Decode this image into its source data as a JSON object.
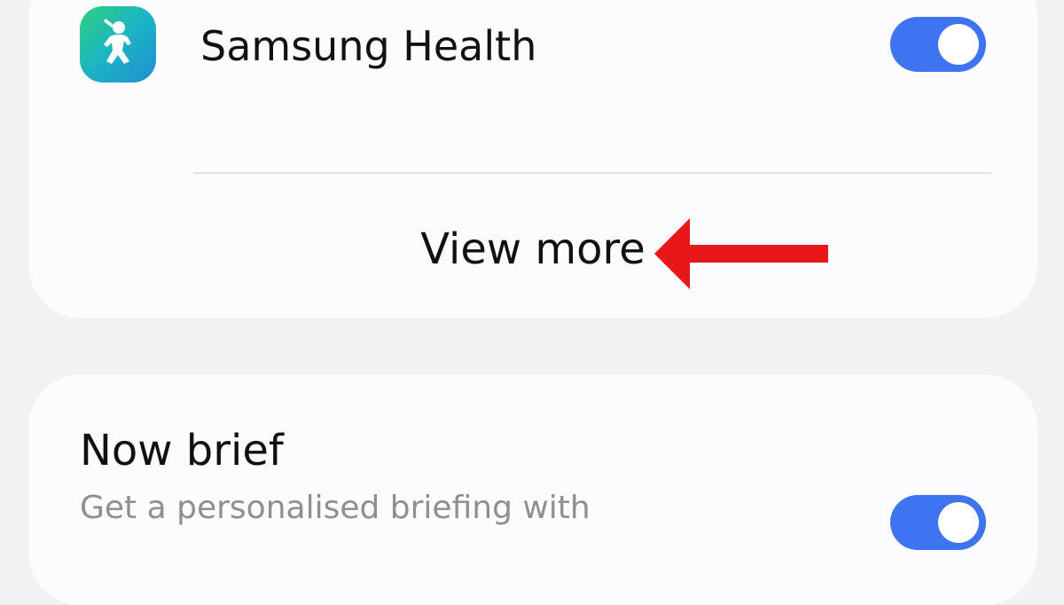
{
  "app_item": {
    "name": "Samsung Health",
    "icon": "samsung-health-icon",
    "toggle_on": true
  },
  "view_more": {
    "label": "View more"
  },
  "annotation": {
    "icon": "arrow-left-icon",
    "color": "#e81818"
  },
  "now_brief": {
    "title": "Now brief",
    "description": "Get a personalised briefing with",
    "toggle_on": true
  },
  "colors": {
    "accent": "#3e74ef",
    "background": "#f2f2f4",
    "card": "#fcfcfe"
  }
}
